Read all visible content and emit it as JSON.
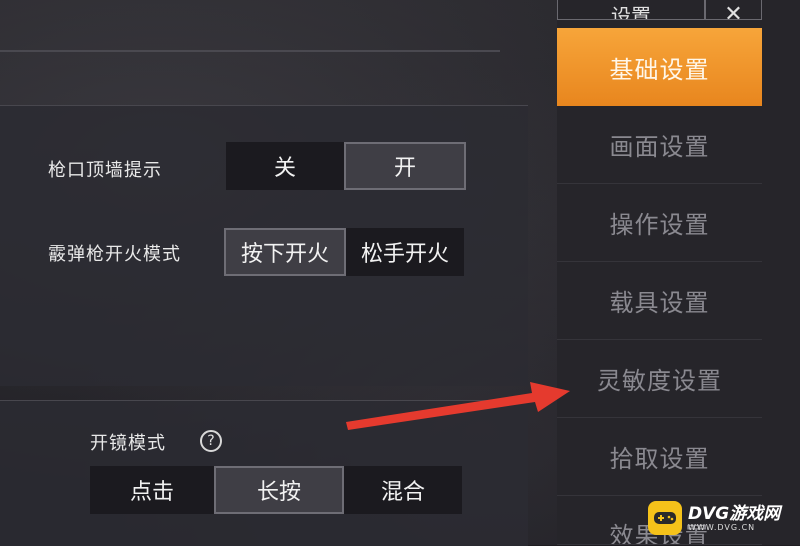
{
  "header": {
    "title": "设置",
    "close_glyph": "✕"
  },
  "sidebar": {
    "items": [
      {
        "label": "基础设置",
        "active": true
      },
      {
        "label": "画面设置",
        "active": false
      },
      {
        "label": "操作设置",
        "active": false
      },
      {
        "label": "载具设置",
        "active": false
      },
      {
        "label": "灵敏度设置",
        "active": false
      },
      {
        "label": "拾取设置",
        "active": false
      },
      {
        "label": "效果设置",
        "active": false
      }
    ]
  },
  "settings": {
    "muzzle_wall_hint": {
      "label": "枪口顶墙提示",
      "options": [
        "关",
        "开"
      ],
      "selected": "开"
    },
    "shotgun_fire_mode": {
      "label": "霰弹枪开火模式",
      "options": [
        "按下开火",
        "松手开火"
      ],
      "selected": "按下开火"
    },
    "scope_mode": {
      "label": "开镜模式",
      "help": "?",
      "options": [
        "点击",
        "长按",
        "混合"
      ],
      "selected": "长按"
    }
  },
  "watermark": {
    "title": "DVG游戏网",
    "sub": "WWW.DVG.CN"
  },
  "colors": {
    "accent": "#f0962a",
    "arrow": "#e53a2e"
  }
}
